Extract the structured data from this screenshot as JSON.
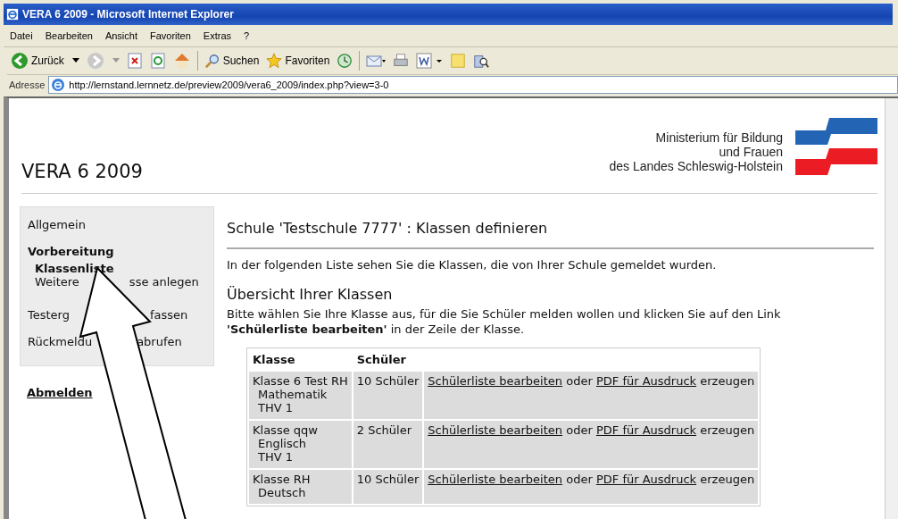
{
  "window": {
    "title": "VERA 6 2009 - Microsoft Internet Explorer"
  },
  "menu": [
    "Datei",
    "Bearbeiten",
    "Ansicht",
    "Favoriten",
    "Extras",
    "?"
  ],
  "toolbar": [
    {
      "kind": "back",
      "label": "Zurück"
    },
    {
      "kind": "forward"
    },
    {
      "kind": "stop"
    },
    {
      "kind": "refresh"
    },
    {
      "kind": "home"
    },
    {
      "kind": "search",
      "label": "Suchen"
    },
    {
      "kind": "favorites",
      "label": "Favoriten"
    },
    {
      "kind": "history"
    },
    {
      "kind": "mail"
    },
    {
      "kind": "print"
    },
    {
      "kind": "edit"
    },
    {
      "kind": "note"
    },
    {
      "kind": "research"
    }
  ],
  "address": {
    "label": "Adresse",
    "value": "http://lernstand.lernnetz.de/preview2009/vera6_2009/index.php?view=3-0"
  },
  "site_title": "VERA 6 2009",
  "ministry": [
    "Ministerium für Bildung",
    "und Frauen",
    "des Landes Schleswig-Holstein"
  ],
  "sidebar": {
    "items": [
      {
        "kind": "link",
        "parts": [
          "Allgemein"
        ]
      },
      {
        "kind": "group",
        "parts": [
          "Vorbereitung"
        ],
        "children": [
          {
            "parts": [
              "Klassenliste"
            ],
            "selected": true
          },
          {
            "parts": [
              "Weitere",
              "sse anlegen"
            ],
            "selected": false
          }
        ]
      },
      {
        "kind": "link",
        "parts": [
          "Testerg",
          "fassen"
        ]
      },
      {
        "kind": "link",
        "parts": [
          "Rückmeldu",
          "abrufen"
        ]
      }
    ],
    "logout": "Abmelden"
  },
  "heading": "Schule 'Testschule 7777' : Klassen definieren",
  "intro": "In der folgenden Liste sehen Sie die Klassen, die von Ihrer Schule gemeldet wurden.",
  "subheading": "Übersicht Ihrer Klassen",
  "instructions": "Bitte wählen Sie Ihre Klasse aus, für die Sie Schüler melden wollen und klicken Sie auf den Link **'Schülerliste bearbeiten'** in der Zeile der Klasse.",
  "table": {
    "columns": [
      "Klasse",
      "Schüler"
    ],
    "rows": [
      {
        "klasse": [
          "Klasse 6 Test RH",
          "Mathematik",
          "THV 1"
        ],
        "schueler": "10 Schüler",
        "link1": "Schülerliste bearbeiten",
        "or": "oder",
        "link2": "PDF für Ausdruck",
        "suffix": "erzeugen"
      },
      {
        "klasse": [
          "Klasse qqw",
          "Englisch",
          "THV 1"
        ],
        "schueler": "2 Schüler",
        "link1": "Schülerliste bearbeiten",
        "or": "oder",
        "link2": "PDF für Ausdruck",
        "suffix": "erzeugen"
      },
      {
        "klasse": [
          "Klasse RH",
          "Deutsch"
        ],
        "schueler": "10 Schüler",
        "link1": "Schülerliste bearbeiten",
        "or": "oder",
        "link2": "PDF für Ausdruck",
        "suffix": "erzeugen"
      }
    ]
  }
}
